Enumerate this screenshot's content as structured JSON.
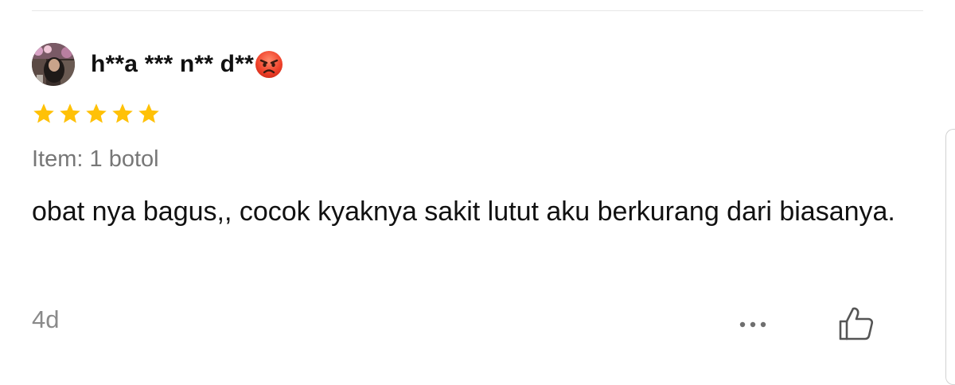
{
  "review": {
    "username": "h**a *** n** d**",
    "username_emoji": "angry-face",
    "rating": 5,
    "rating_max": 5,
    "variant": "Item: 1 botol",
    "comment": "obat nya bagus,, cocok kyaknya sakit lutut aku berkurang dari biasanya.",
    "time_ago": "4d"
  },
  "icons": {
    "more": "more-horizontal-icon",
    "like": "thumbs-up-icon",
    "star": "star-icon"
  },
  "colors": {
    "star": "#FFC107",
    "muted_text": "#777777",
    "primary_text": "#111111"
  }
}
